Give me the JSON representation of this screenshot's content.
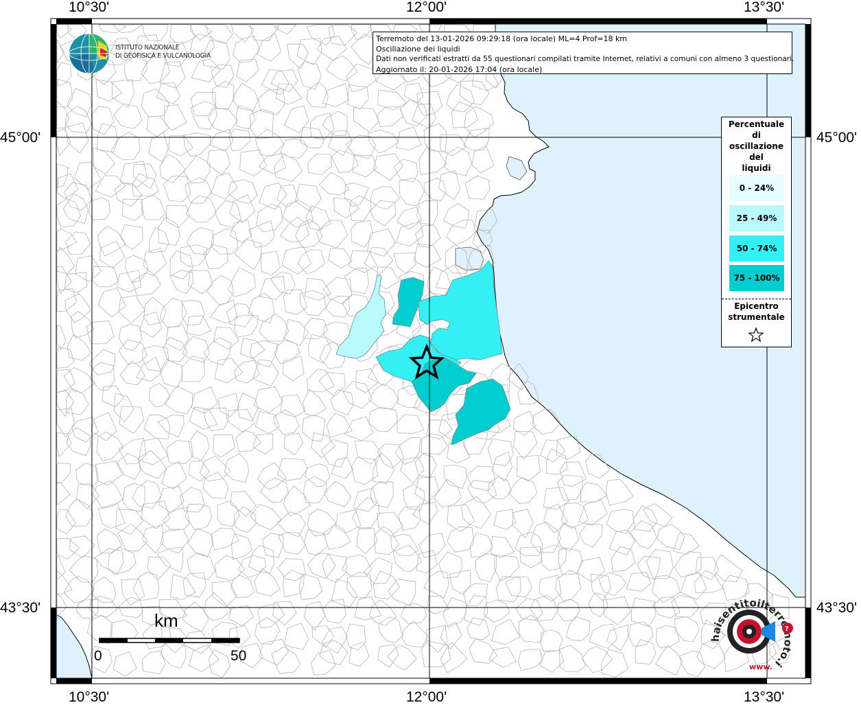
{
  "coordinates": {
    "lon_labels": [
      "10°30'",
      "12°00'",
      "13°30'"
    ],
    "lat_labels": [
      "45°00'",
      "43°30'"
    ]
  },
  "info": {
    "line1": "Terremoto del 13-01-2026 09:29:18 (ora locale) ML=4 Prof=18 km",
    "line2": "Oscillazione dei liquidi",
    "line3": "Dati non verificati estratti da 55 questionari compilati tramite Internet, relativi a comuni con almeno 3 questionari.",
    "line4": "Aggiornato il: 20-01-2026 17:04 (ora locale)"
  },
  "logo": {
    "line1": "ISTITUTO NAZIONALE",
    "line2": "DI GEOFISICA E VULCANOLOGIA"
  },
  "legend": {
    "title_lines": [
      "Percentuale",
      "di",
      "oscillazione",
      "del",
      "liquidi"
    ],
    "classes": [
      {
        "label": "0 - 24%",
        "color": "#e6feff"
      },
      {
        "label": "25 - 49%",
        "color": "#b8faff"
      },
      {
        "label": "50 - 74%",
        "color": "#33f0f5"
      },
      {
        "label": "75 - 100%",
        "color": "#00cdd0"
      }
    ],
    "epicenter_lines": [
      "Epicentro",
      "strumentale"
    ],
    "epicenter_icon": "star-icon"
  },
  "scale_bar": {
    "unit": "km",
    "start": "0",
    "end": "50"
  },
  "brand": {
    "text": "haisentitoilterremoto.it",
    "prefix": "www.",
    "icon": "target-megaphone-icon"
  },
  "colors": {
    "sea": "#dff1fc",
    "land": "#ffffff",
    "border": "#b4b4b4"
  }
}
